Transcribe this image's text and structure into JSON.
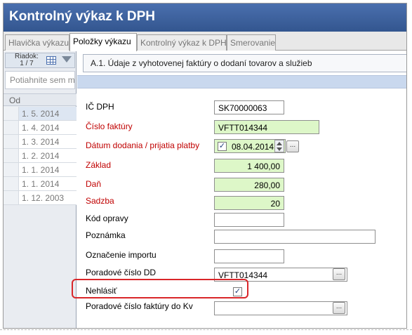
{
  "window": {
    "title": "Kontrolný výkaz k DPH"
  },
  "tabs": [
    {
      "label": "Hlavička výkazu"
    },
    {
      "label": "Položky výkazu"
    },
    {
      "label": "Kontrolný výkaz k DPH"
    },
    {
      "label": "Smerovanie"
    }
  ],
  "left_panel": {
    "row_label": "Riadok:",
    "row_counter": "1 / 7",
    "group_placeholder": "Potiahnite sem m",
    "column_header": "Od",
    "dates": [
      "1. 5. 2014",
      "1. 4. 2014",
      "1. 3. 2014",
      "1. 2. 2014",
      "1. 1. 2014",
      "1. 1. 2014",
      "1. 12. 2003"
    ]
  },
  "main": {
    "section_title": "A.1. Údaje z vyhotovenej faktúry o dodaní tovarov a služieb",
    "fields": {
      "ic_dph": {
        "label": "IČ DPH",
        "value": "SK70000063"
      },
      "cislo_faktury": {
        "label": "Číslo faktúry",
        "value": "VFTT014344"
      },
      "datum_dodania": {
        "label": "Dátum dodania / prijatia platby",
        "value": "08.04.2014",
        "checked": true
      },
      "zaklad": {
        "label": "Základ",
        "value": "1 400,00"
      },
      "dan": {
        "label": "Daň",
        "value": "280,00"
      },
      "sadzba": {
        "label": "Sadzba",
        "value": "20"
      },
      "kod_opravy": {
        "label": "Kód opravy",
        "value": ""
      },
      "poznamka": {
        "label": "Poznámka",
        "value": ""
      },
      "oznacenie_importu": {
        "label": "Označenie importu",
        "value": ""
      },
      "poradove_cislo_dd": {
        "label": "Poradové číslo DD",
        "value": "VFTT014344"
      },
      "nehlasit": {
        "label": "Nehlásiť",
        "checked": true
      },
      "poradove_cislo_faktury_kv": {
        "label": "Poradové číslo faktúry do Kv",
        "value": ""
      }
    },
    "ellipsis": "..."
  },
  "colors": {
    "title_bg": "#3b5f9e",
    "required": "#c00000",
    "required_field_bg": "#ddf7c8",
    "highlight": "#d9262a"
  }
}
